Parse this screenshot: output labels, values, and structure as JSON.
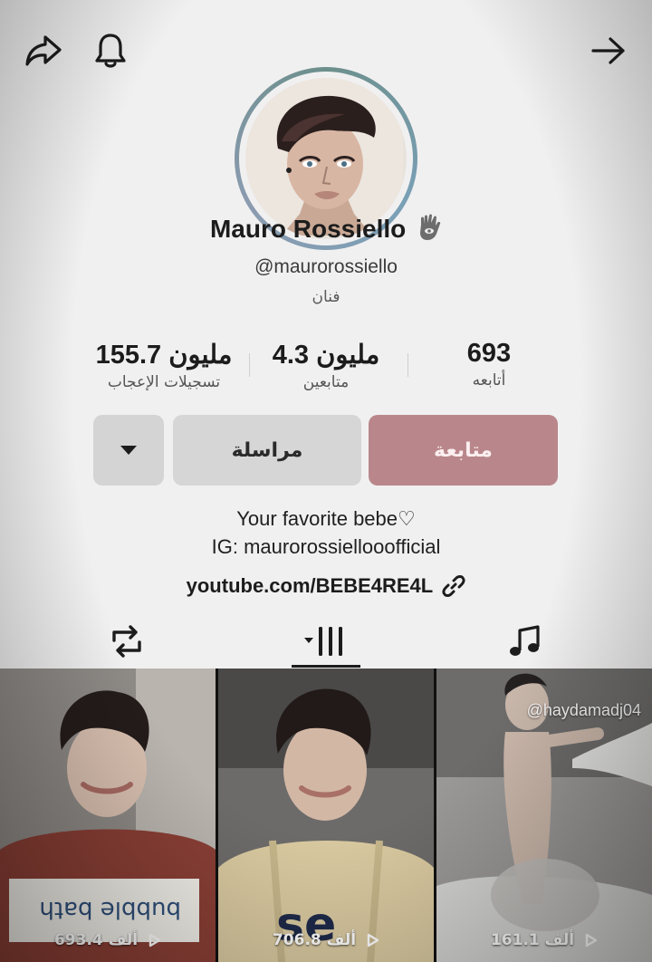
{
  "header": {
    "icons": [
      "share-icon",
      "bell-icon",
      "arrow-right-icon"
    ]
  },
  "profile": {
    "display_name": "Mauro Rossiello",
    "badge_icon": "hamsa-hand-icon",
    "handle": "@maurorossiello",
    "category": "فنان"
  },
  "stats": {
    "following": {
      "value": "693",
      "label": "أتابعه"
    },
    "followers": {
      "value": "4.3 مليون",
      "label": "متابعين"
    },
    "likes": {
      "value": "155.7 مليون",
      "label": "تسجيلات الإعجاب"
    }
  },
  "actions": {
    "follow_label": "متابعة",
    "message_label": "مراسلة",
    "follow_color": "#b9878b"
  },
  "bio": {
    "line1": "Your favorite bebe♡",
    "line2": "IG: maurorossiellooofficial",
    "link": "youtube.com/BEBE4RE4L"
  },
  "tabs": [
    {
      "name": "reposts",
      "icon": "repost-icon"
    },
    {
      "name": "videos",
      "icon": "grid-icon",
      "active": true
    },
    {
      "name": "sounds",
      "icon": "music-note-icon"
    }
  ],
  "videos": [
    {
      "views": "693.4 ألف"
    },
    {
      "views": "706.8 ألف"
    },
    {
      "views": "161.1 ألف",
      "watermark": "@haydamadj04"
    }
  ]
}
